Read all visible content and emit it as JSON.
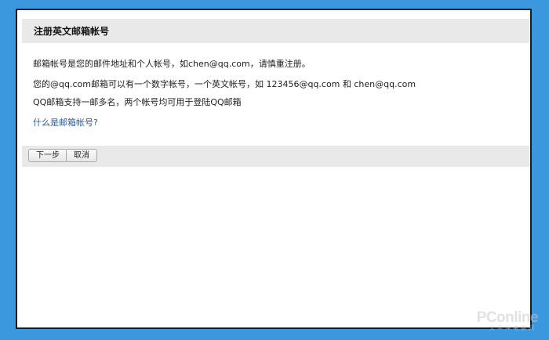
{
  "dialog": {
    "title": "注册英文邮箱帐号",
    "lines": [
      "邮箱帐号是您的邮件地址和个人帐号，如chen@qq.com，请慎重注册。",
      "您的@qq.com邮箱可以有一个数字帐号，一个英文帐号，如 123456@qq.com 和 chen@qq.com",
      "QQ邮箱支持一邮多名，两个帐号均可用于登陆QQ邮箱"
    ],
    "help_link": "什么是邮箱帐号?",
    "buttons": {
      "next": "下一步",
      "cancel": "取消"
    }
  },
  "watermark": {
    "brand": "PConline",
    "sub": "太平洋电脑网"
  },
  "colors": {
    "background": "#3b97de",
    "link": "#2d5aa1",
    "panel": "#e9e9e9"
  }
}
